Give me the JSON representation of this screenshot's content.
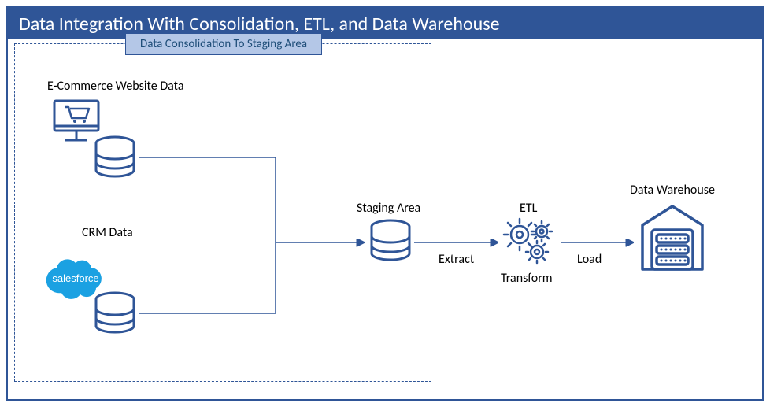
{
  "title": "Data Integration With Consolidation, ETL, and Data Warehouse",
  "consolidation_label": "Data Consolidation To Staging Area",
  "sources": {
    "ecommerce_label": "E-Commerce Website Data",
    "crm_label": "CRM Data",
    "salesforce_label": "salesforce"
  },
  "staging_label": "Staging Area",
  "etl": {
    "label": "ETL",
    "extract": "Extract",
    "transform": "Transform",
    "load": "Load"
  },
  "warehouse_label": "Data Warehouse",
  "colors": {
    "primary": "#2f5597",
    "badge_fill": "#b4c7e7",
    "salesforce": "#1ba1e2"
  }
}
